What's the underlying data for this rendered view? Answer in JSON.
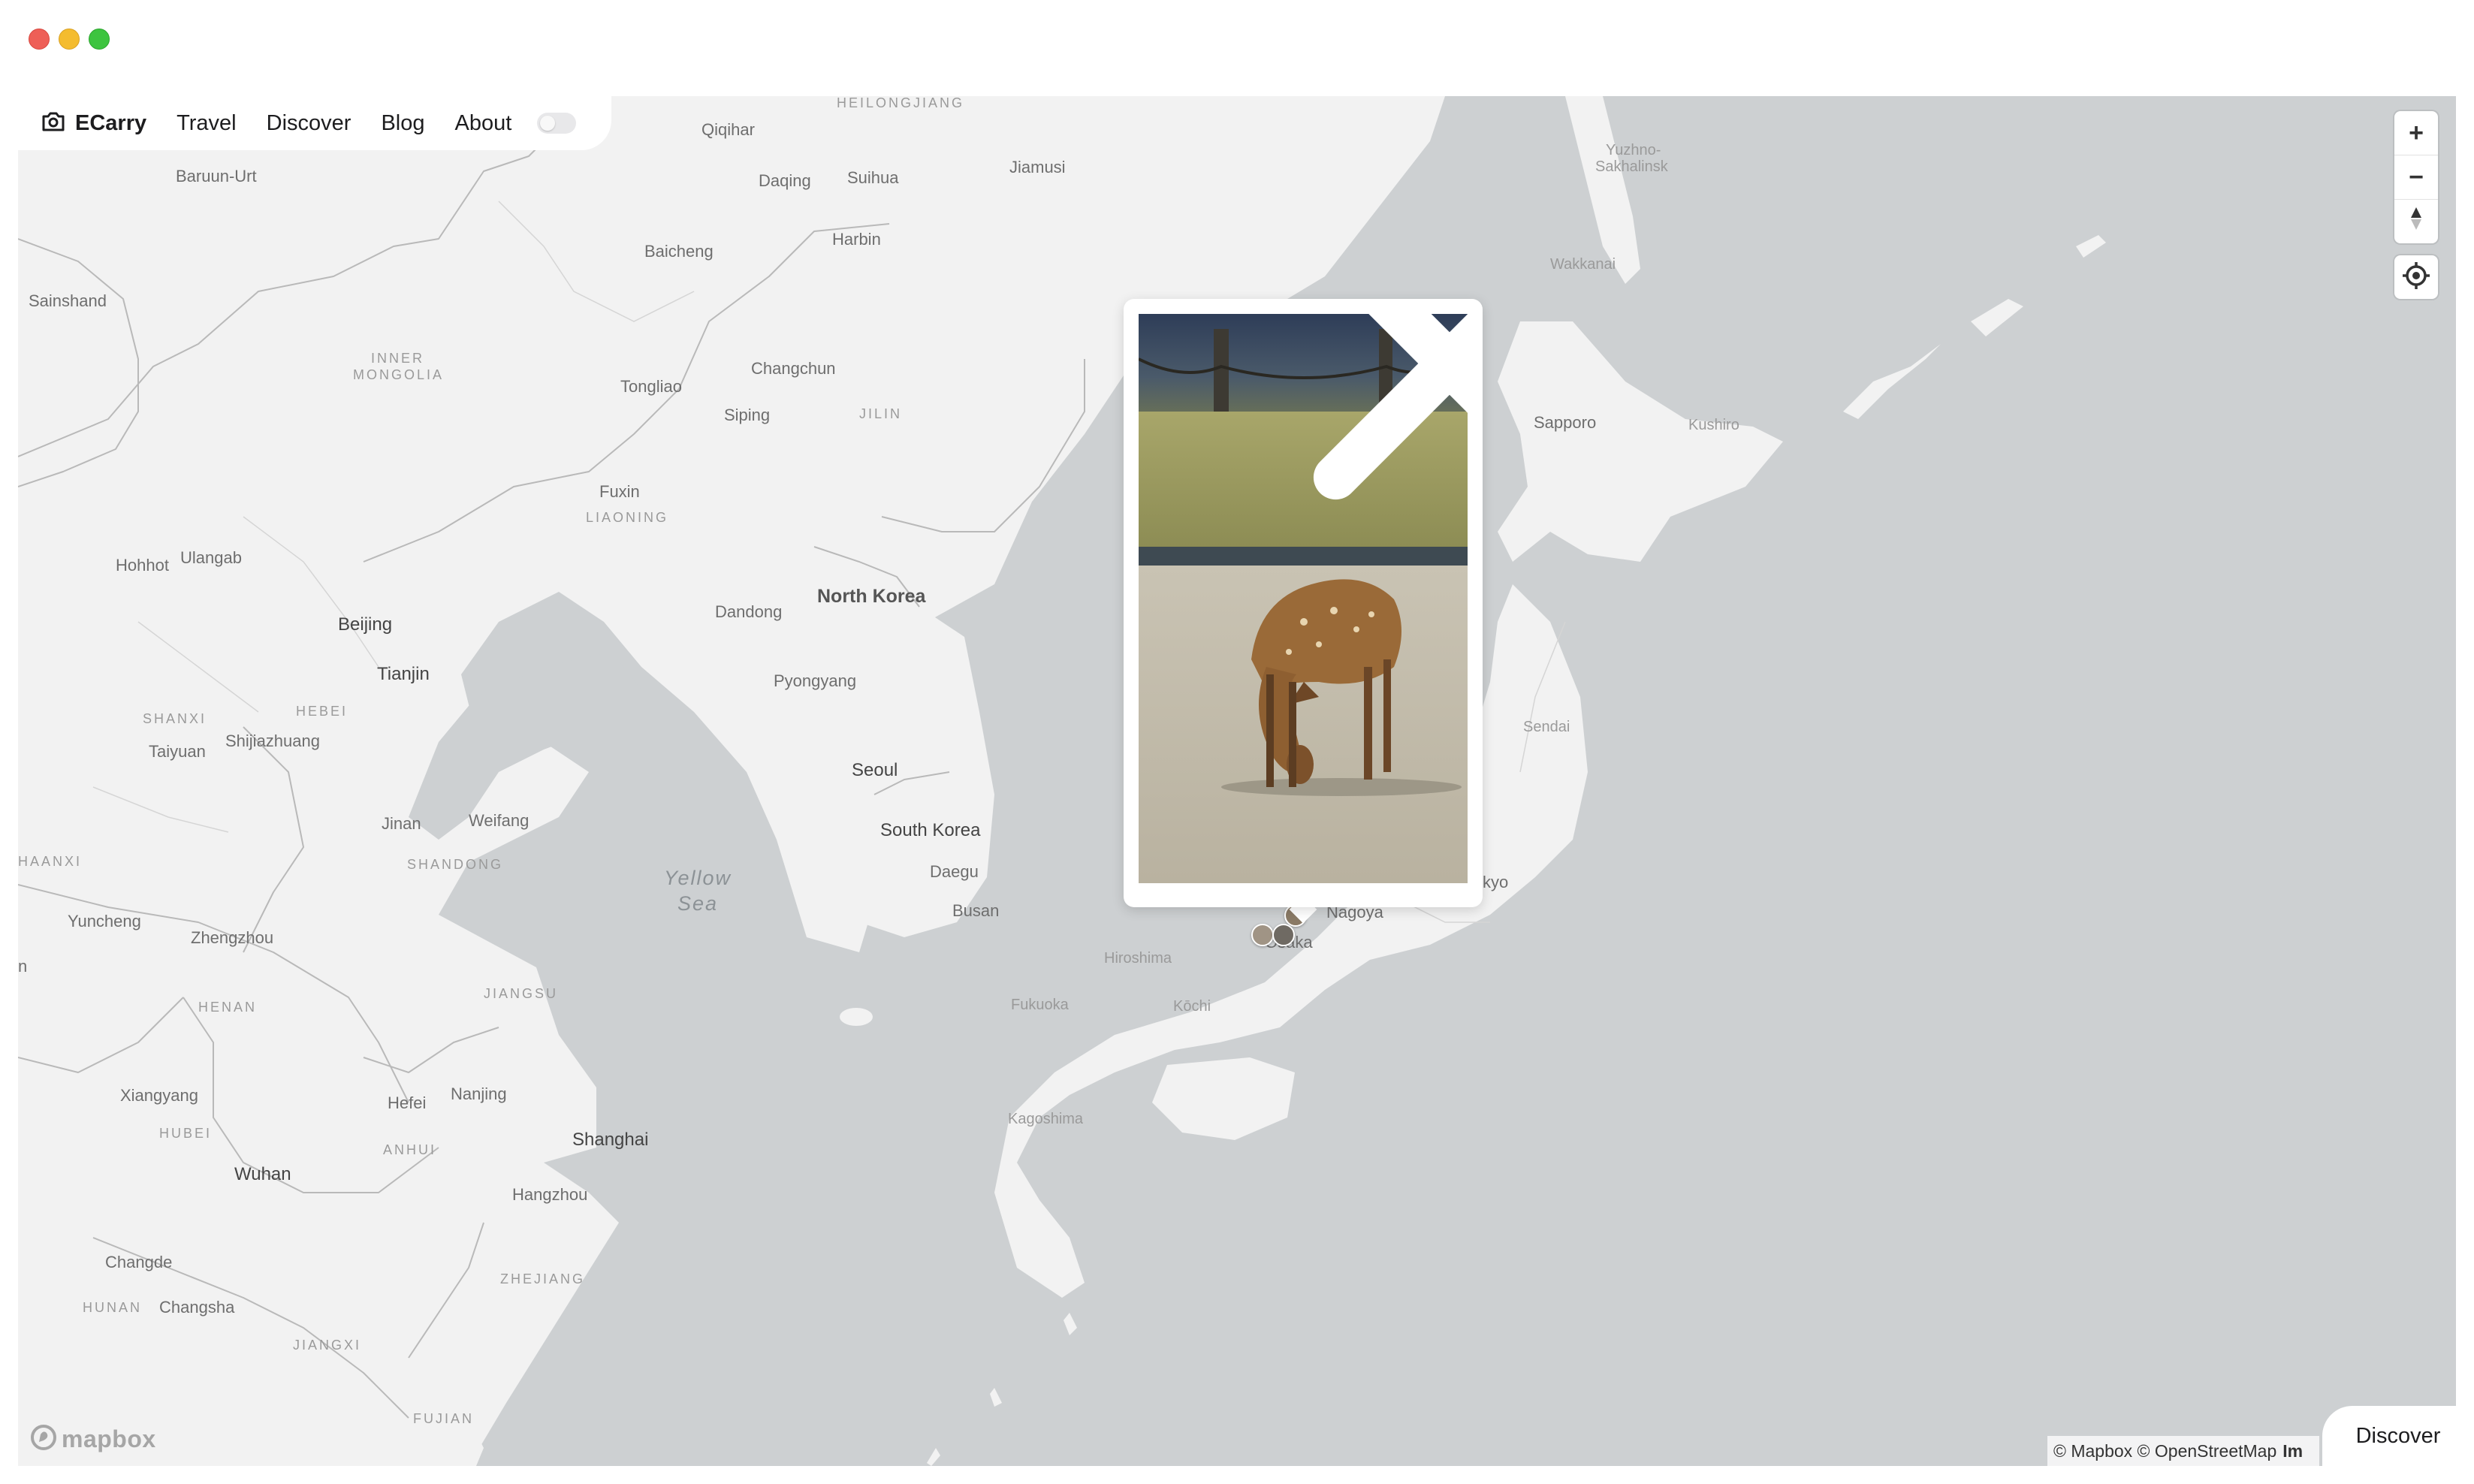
{
  "nav": {
    "brand": "ECarry",
    "links": [
      "Travel",
      "Discover",
      "Blog",
      "About"
    ]
  },
  "map": {
    "labels": {
      "heilongjiang": "HEILONGJIANG",
      "qiqihar": "Qiqihar",
      "jiamusi": "Jiamusi",
      "baruun_urt": "Baruun-Urt",
      "daqing": "Daqing",
      "suihua": "Suihua",
      "harbin": "Harbin",
      "baicheng": "Baicheng",
      "sainshand": "Sainshand",
      "inner_mongolia_1": "INNER",
      "inner_mongolia_2": "MONGOLIA",
      "changchun": "Changchun",
      "tongliao": "Tongliao",
      "siping": "Siping",
      "jilin": "JILIN",
      "fuxin": "Fuxin",
      "liaoning": "LIAONING",
      "hohhot": "Hohhot",
      "ulangab": "Ulangab",
      "beijing": "Beijing",
      "tianjin": "Tianjin",
      "dandong": "Dandong",
      "north_korea": "North Korea",
      "pyongyang": "Pyongyang",
      "shanxi": "SHANXI",
      "hebei": "HEBEI",
      "taiyuan": "Taiyuan",
      "shijiazhuang": "Shijiazhuang",
      "seoul": "Seoul",
      "jinan": "Jinan",
      "weifang": "Weifang",
      "shandong": "SHANDONG",
      "haanxi": "HAANXI",
      "south_korea": "South Korea",
      "daegu": "Daegu",
      "busan": "Busan",
      "yellow_sea_1": "Yellow",
      "yellow_sea_2": "Sea",
      "yuncheng": "Yuncheng",
      "zhengzhou": "Zhengzhou",
      "henan": "HENAN",
      "jiangsu": "JIANGSU",
      "edge_n": "n",
      "xiangyang": "Xiangyang",
      "hefei": "Hefei",
      "nanjing": "Nanjing",
      "hubei": "HUBEI",
      "anhui": "ANHUI",
      "shanghai": "Shanghai",
      "wuhan": "Wuhan",
      "hangzhou": "Hangzhou",
      "changde": "Changde",
      "zhejiang": "ZHEJIANG",
      "hunan": "HUNAN",
      "changsha": "Changsha",
      "jiangxi": "JIANGXI",
      "fujian": "FUJIAN",
      "yuzhno_1": "Yuzhno-",
      "yuzhno_2": "Sakhalinsk",
      "wakkanai": "Wakkanai",
      "sapporo": "Sapporo",
      "kushiro": "Kushiro",
      "sendai": "Sendai",
      "tokyo_partial": "kyo",
      "nagoya": "Nagoya",
      "osaka": "Osaka",
      "hiroshima": "Hiroshima",
      "fukuoka": "Fukuoka",
      "kochi": "Kōchi",
      "kagoshima": "Kagoshima"
    },
    "colors": {
      "water": "#cdd0d2",
      "land": "#f2f2f2",
      "border": "#b9b9b9"
    }
  },
  "controls": {
    "zoom_in": "+",
    "zoom_out": "−"
  },
  "attribution": {
    "logo": "mapbox",
    "text": "© Mapbox © OpenStreetMap",
    "tail": "Im"
  },
  "discover_button": "Discover"
}
